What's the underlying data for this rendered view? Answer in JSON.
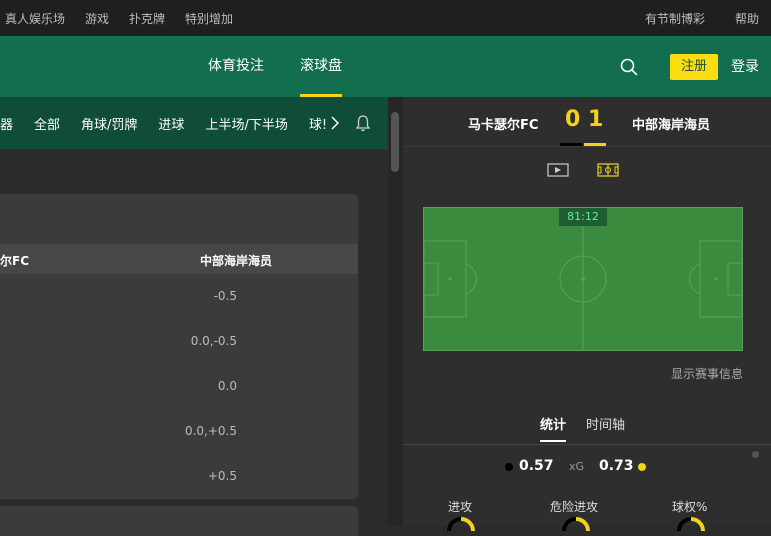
{
  "topbar": {
    "left": [
      "真人娱乐场",
      "游戏",
      "扑克牌",
      "特别增加"
    ],
    "right": [
      "有节制博彩",
      "帮助"
    ]
  },
  "header": {
    "nav": [
      {
        "label": "体育投注"
      },
      {
        "label": "滚球盘",
        "active": true
      }
    ],
    "register": "注册",
    "login": "登录"
  },
  "subnav": {
    "tabs": [
      "器",
      "全部",
      "角球/罚牌",
      "进球",
      "上半场/下半场",
      "球!"
    ]
  },
  "market": {
    "home_team": "尔FC",
    "away_team": "中部海岸海员",
    "lines": [
      "-0.5",
      "0.0,-0.5",
      "0.0",
      "0.0,+0.5",
      "+0.5"
    ]
  },
  "match": {
    "home": "马卡瑟尔FC",
    "away": "中部海岸海员",
    "home_score": "0",
    "away_score": "1",
    "clock": "81:12",
    "show_info": "显示赛事信息",
    "tabs": [
      "统计",
      "时间轴"
    ],
    "xg_home": "0.57",
    "xg_label": "xG",
    "xg_away": "0.73",
    "stats": [
      "进攻",
      "危险进攻",
      "球权%"
    ]
  },
  "colors": {
    "brand_green": "#126e4e",
    "accent_yellow": "#f7d31b",
    "pitch_green": "#3a8b3d"
  }
}
